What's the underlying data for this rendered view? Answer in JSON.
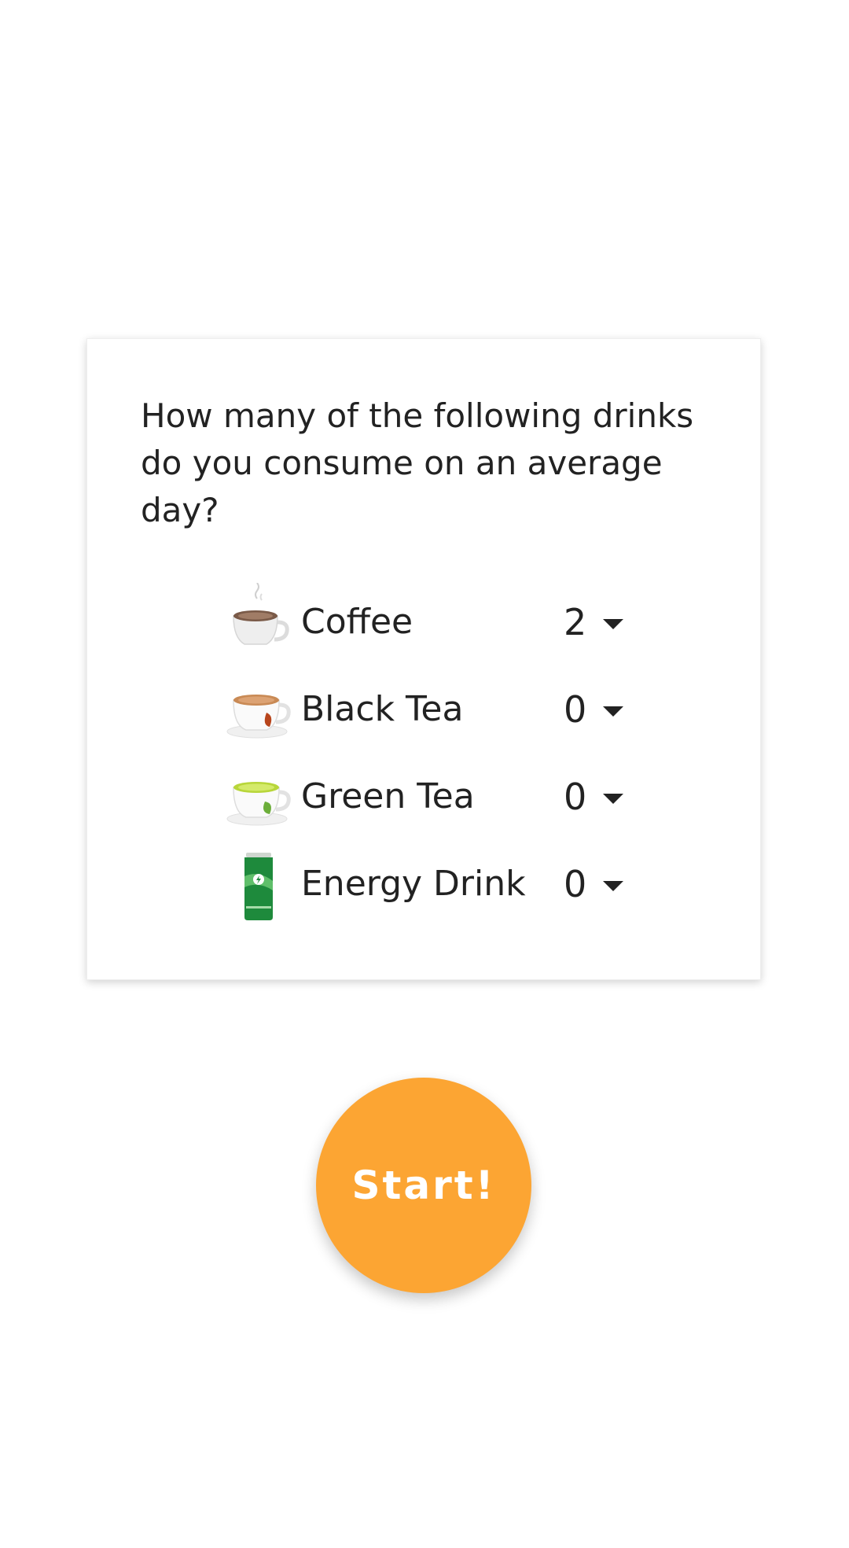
{
  "question": "How many of the following drinks do you consume on an average day?",
  "drinks": [
    {
      "label": "Coffee",
      "count": "2",
      "icon": "coffee-cup-icon"
    },
    {
      "label": "Black Tea",
      "count": "0",
      "icon": "black-tea-cup-icon"
    },
    {
      "label": "Green Tea",
      "count": "0",
      "icon": "green-tea-cup-icon"
    },
    {
      "label": "Energy Drink",
      "count": "0",
      "icon": "energy-drink-can-icon"
    }
  ],
  "start_label": "Start!",
  "colors": {
    "accent": "#fca533",
    "text": "#222222",
    "energy_can": "#1e8a3c",
    "green_tea": "#c9e04b",
    "black_tea": "#c98a55",
    "coffee": "#8a6a55"
  }
}
